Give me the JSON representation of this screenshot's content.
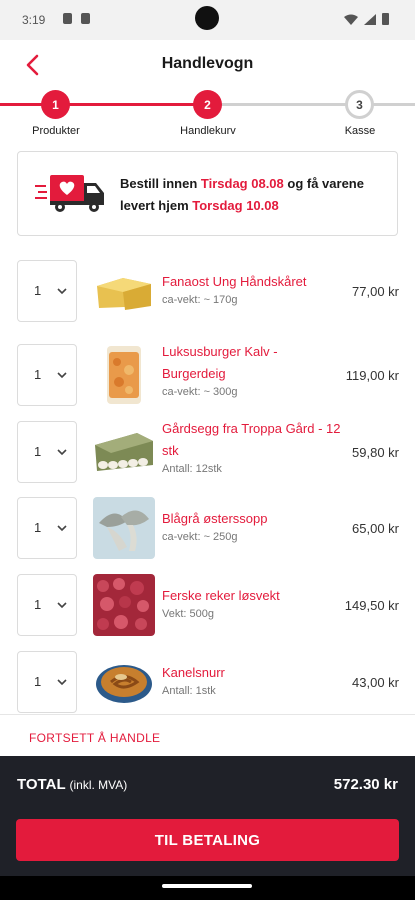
{
  "status_bar": {
    "time": "3:19"
  },
  "header": {
    "title": "Handlevogn"
  },
  "stepper": {
    "steps": [
      {
        "number": "1",
        "label": "Produkter",
        "state": "active"
      },
      {
        "number": "2",
        "label": "Handlekurv",
        "state": "active"
      },
      {
        "number": "3",
        "label": "Kasse",
        "state": "inactive"
      }
    ],
    "accent_color": "#e31b3c"
  },
  "delivery": {
    "text_a": "Bestill innen ",
    "order_by": "Tirsdag 08.08",
    "text_b": " og få varene levert hjem ",
    "delivery_day": "Torsdag 10.08",
    "icon": "delivery-truck-heart-icon"
  },
  "cart": {
    "items": [
      {
        "qty": "1",
        "name": "Fanaost Ung Håndskåret",
        "sub": "ca-vekt: ~ 170g",
        "price": "77,00 kr",
        "image": "cheese"
      },
      {
        "qty": "1",
        "name": "Luksusburger Kalv - Burgerdeig",
        "sub": "ca-vekt: ~ 300g",
        "price": "119,00 kr",
        "image": "burger-meat"
      },
      {
        "qty": "1",
        "name": "Gårdsegg fra Troppa Gård - 12 stk",
        "sub": "Antall: 12stk",
        "price": "59,80 kr",
        "image": "eggs"
      },
      {
        "qty": "1",
        "name": "Blågrå østerssopp",
        "sub": "ca-vekt: ~ 250g",
        "price": "65,00 kr",
        "image": "mushrooms"
      },
      {
        "qty": "1",
        "name": "Ferske reker løsvekt",
        "sub": "Vekt: 500g",
        "price": "149,50 kr",
        "image": "shrimp"
      },
      {
        "qty": "1",
        "name": "Kanelsnurr",
        "sub": "Antall: 1stk",
        "price": "43,00 kr",
        "image": "cinnamon-bun"
      }
    ]
  },
  "continue_shopping": "FORTSETT Å HANDLE",
  "footer": {
    "total_label": "TOTAL",
    "total_note": "(inkl. MVA)",
    "total_value": "572.30 kr",
    "pay_button": "TIL BETALING"
  }
}
